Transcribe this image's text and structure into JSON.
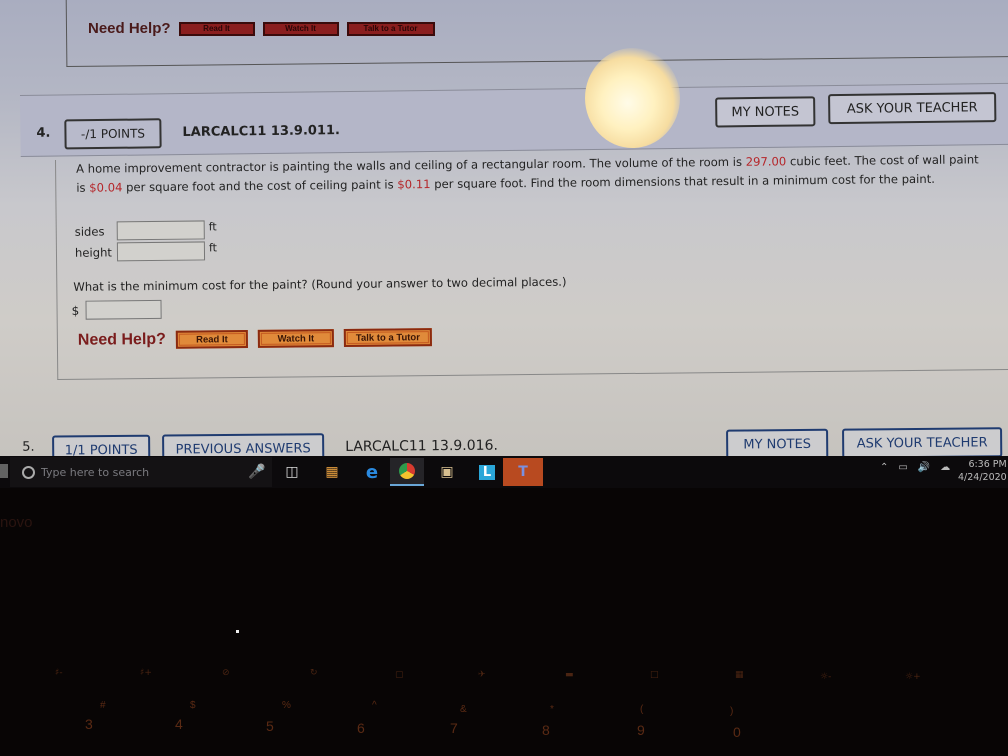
{
  "previous_question": {
    "need_help_label": "Need Help?",
    "buttons": [
      "Read It",
      "Watch It",
      "Talk to a Tutor"
    ]
  },
  "question4": {
    "number": "4.",
    "points": "-/1 POINTS",
    "code": "LARCALC11 13.9.011.",
    "my_notes": "MY NOTES",
    "ask_teacher": "ASK YOUR TEACHER",
    "text_parts": {
      "p1": "A home improvement contractor is painting the walls and ceiling of a rectangular room. The volume of the room is ",
      "volume": "297.00",
      "p2": " cubic feet. The cost of wall paint is ",
      "wall_cost": "$0.04",
      "p3": " per square foot and the cost of ceiling paint is ",
      "ceiling_cost": "$0.11",
      "p4": " per square foot. Find the room dimensions that result in a minimum cost for the paint."
    },
    "fields": [
      {
        "label": "sides",
        "value": "",
        "unit": "ft"
      },
      {
        "label": "height",
        "value": "",
        "unit": "ft"
      }
    ],
    "min_cost_prompt": "What is the minimum cost for the paint? (Round your answer to two decimal places.)",
    "currency": "$",
    "min_cost_value": "",
    "need_help_label": "Need Help?",
    "help_buttons": [
      "Read It",
      "Watch It",
      "Talk to a Tutor"
    ]
  },
  "question5": {
    "number": "5.",
    "points": "1/1 POINTS",
    "previous_answers": "PREVIOUS ANSWERS",
    "code": "LARCALC11 13.9.016.",
    "my_notes": "MY NOTES",
    "ask_teacher": "ASK YOUR TEACHER"
  },
  "taskbar": {
    "search_placeholder": "Type here to search",
    "apps": [
      "microphone",
      "task-view",
      "store",
      "edge",
      "chrome",
      "file-explorer",
      "launcher-L",
      "teams"
    ],
    "time": "6:36 PM",
    "date": "4/24/2020"
  },
  "laptop": {
    "brand_fragment": "novo",
    "number_keys": [
      "3",
      "4",
      "5",
      "6",
      "7",
      "8",
      "9",
      "0"
    ],
    "symbol_keys": [
      "#",
      "$",
      "%",
      "^",
      "&",
      "*",
      "(",
      ")"
    ]
  },
  "colors": {
    "highlight_red": "#b5262a",
    "help_orange": "#e08a3a",
    "q5_blue": "#1f3b70"
  }
}
